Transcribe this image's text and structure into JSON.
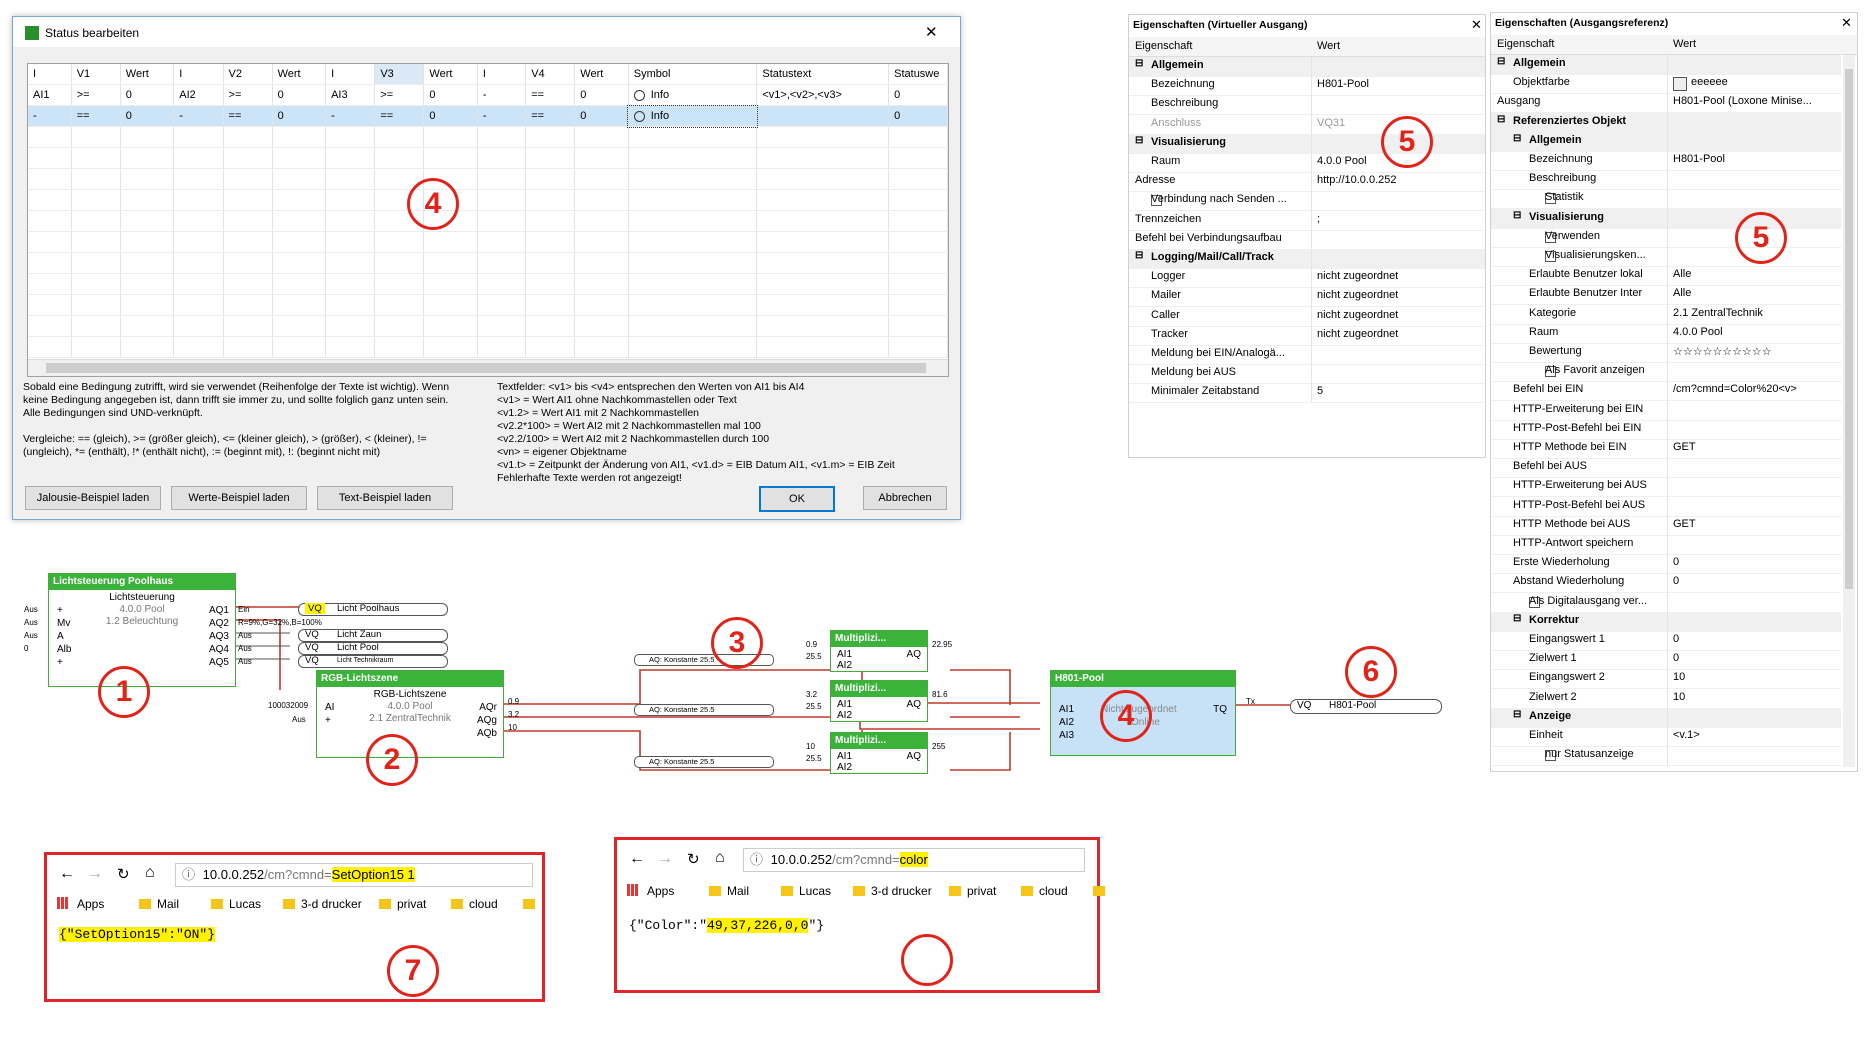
{
  "dialog": {
    "title": "Status bearbeiten",
    "columns": [
      "I",
      "V1",
      "Wert",
      "I",
      "V2",
      "Wert",
      "I",
      "V3",
      "Wert",
      "I",
      "V4",
      "Wert",
      "Symbol",
      "Statustext",
      "Statuswe"
    ],
    "rows": [
      [
        "AI1",
        ">=",
        "0",
        "AI2",
        ">=",
        "0",
        "AI3",
        ">=",
        "0",
        "-",
        "==",
        "0",
        "Info",
        "<v1>,<v2>,<v3>",
        "0"
      ],
      [
        "-",
        "==",
        "0",
        "-",
        "==",
        "0",
        "-",
        "==",
        "0",
        "-",
        "==",
        "0",
        "Info",
        "",
        "0"
      ]
    ],
    "help_left": [
      "Sobald eine Bedingung zutrifft, wird sie verwendet (Reihenfolge der Texte ist wichtig). Wenn",
      "keine Bedingung angegeben ist, dann trifft sie immer zu, und sollte folglich ganz unten sein.",
      "Alle Bedingungen sind UND-verknüpft.",
      "",
      "Vergleiche: == (gleich), >= (größer gleich), <= (kleiner gleich), > (größer), < (kleiner), !=",
      "(ungleich), *= (enthält), !* (enthält nicht), := (beginnt mit), !: (beginnt nicht mit)"
    ],
    "help_right": [
      "Textfelder: <v1> bis <v4> entsprechen den Werten von AI1 bis AI4",
      "<v1> = Wert AI1 ohne Nachkommastellen oder Text",
      "<v1.2> = Wert AI1 mit 2 Nachkommastellen",
      "<v2.2*100> = Wert AI2 mit 2 Nachkommastellen mal 100",
      "<v2.2/100> = Wert AI2 mit 2 Nachkommastellen durch 100",
      "<vn> = eigener Objektname",
      "<v1.t> = Zeitpunkt der Änderung von AI1, <v1.d> = EIB Datum AI1, <v1.m> = EIB Zeit",
      "Fehlerhafte Texte werden rot angezeigt!"
    ],
    "buttons": {
      "jalousie": "Jalousie-Beispiel laden",
      "werte": "Werte-Beispiel laden",
      "text": "Text-Beispiel laden",
      "ok": "OK",
      "cancel": "Abbrechen"
    },
    "close": "✕"
  },
  "panel1": {
    "title": "Eigenschaften (Virtueller Ausgang)",
    "col_key": "Eigenschaft",
    "col_val": "Wert",
    "rows": [
      {
        "k": "Allgemein",
        "v": "",
        "cat": true,
        "ind": 0
      },
      {
        "k": "Bezeichnung",
        "v": "H801-Pool",
        "ind": 1
      },
      {
        "k": "Beschreibung",
        "v": "",
        "ind": 1
      },
      {
        "k": "Anschluss",
        "v": "VQ31",
        "ind": 1,
        "grey": true
      },
      {
        "k": "Visualisierung",
        "v": "",
        "cat": true,
        "ind": 0
      },
      {
        "k": "Raum",
        "v": "4.0.0 Pool",
        "ind": 1
      },
      {
        "k": "Adresse",
        "v": "http://10.0.0.252",
        "ind": 0
      },
      {
        "k": "Verbindung nach Senden ...",
        "v": "",
        "ind": 0,
        "check": true
      },
      {
        "k": "Trennzeichen",
        "v": ";",
        "ind": 0
      },
      {
        "k": "Befehl bei Verbindungsaufbau",
        "v": "",
        "ind": 0
      },
      {
        "k": "Logging/Mail/Call/Track",
        "v": "",
        "cat": true,
        "ind": 0
      },
      {
        "k": "Logger",
        "v": "nicht zugeordnet",
        "ind": 1
      },
      {
        "k": "Mailer",
        "v": "nicht zugeordnet",
        "ind": 1
      },
      {
        "k": "Caller",
        "v": "nicht zugeordnet",
        "ind": 1
      },
      {
        "k": "Tracker",
        "v": "nicht zugeordnet",
        "ind": 1
      },
      {
        "k": "Meldung bei EIN/Analogä...",
        "v": "",
        "ind": 1
      },
      {
        "k": "Meldung bei AUS",
        "v": "",
        "ind": 1
      },
      {
        "k": "Minimaler Zeitabstand",
        "v": "5",
        "ind": 1
      }
    ]
  },
  "panel2": {
    "title": "Eigenschaften (Ausgangsreferenz)",
    "col_key": "Eigenschaft",
    "col_val": "Wert",
    "rows": [
      {
        "k": "Allgemein",
        "v": "",
        "cat": true,
        "ind": 0
      },
      {
        "k": "Objektfarbe",
        "v": "eeeeee",
        "ind": 1,
        "swatch": true
      },
      {
        "k": "Ausgang",
        "v": "H801-Pool (Loxone Minise...",
        "ind": 0
      },
      {
        "k": "Referenziertes Objekt",
        "v": "",
        "cat": true,
        "ind": 0
      },
      {
        "k": "Allgemein",
        "v": "",
        "cat": true,
        "ind": 1
      },
      {
        "k": "Bezeichnung",
        "v": "H801-Pool",
        "ind": 2
      },
      {
        "k": "Beschreibung",
        "v": "",
        "ind": 2
      },
      {
        "k": "Statistik",
        "v": "",
        "ind": 2,
        "check": true
      },
      {
        "k": "Visualisierung",
        "v": "",
        "cat": true,
        "ind": 1
      },
      {
        "k": "Verwenden",
        "v": "",
        "ind": 2,
        "check": true
      },
      {
        "k": "Visualisierungsken...",
        "v": "",
        "ind": 2,
        "check": true
      },
      {
        "k": "Erlaubte Benutzer lokal",
        "v": "Alle",
        "ind": 2
      },
      {
        "k": "Erlaubte Benutzer Inter",
        "v": "Alle",
        "ind": 2
      },
      {
        "k": "Kategorie",
        "v": "2.1 ZentralTechnik",
        "ind": 2
      },
      {
        "k": "Raum",
        "v": "4.0.0 Pool",
        "ind": 2
      },
      {
        "k": "Bewertung",
        "v": "☆☆☆☆☆☆☆☆☆☆",
        "ind": 2
      },
      {
        "k": "Als Favorit anzeigen",
        "v": "",
        "ind": 2,
        "check": true
      },
      {
        "k": "Befehl bei EIN",
        "v": "/cm?cmnd=Color%20<v>",
        "ind": 1
      },
      {
        "k": "HTTP-Erweiterung bei EIN",
        "v": "",
        "ind": 1
      },
      {
        "k": "HTTP-Post-Befehl bei EIN",
        "v": "",
        "ind": 1
      },
      {
        "k": "HTTP Methode bei EIN",
        "v": "GET",
        "ind": 1
      },
      {
        "k": "Befehl bei AUS",
        "v": "",
        "ind": 1
      },
      {
        "k": "HTTP-Erweiterung bei AUS",
        "v": "",
        "ind": 1
      },
      {
        "k": "HTTP-Post-Befehl bei AUS",
        "v": "",
        "ind": 1
      },
      {
        "k": "HTTP Methode bei AUS",
        "v": "GET",
        "ind": 1
      },
      {
        "k": "HTTP-Antwort speichern",
        "v": "",
        "ind": 1
      },
      {
        "k": "Erste Wiederholung",
        "v": "0",
        "ind": 1
      },
      {
        "k": "Abstand Wiederholung",
        "v": "0",
        "ind": 1
      },
      {
        "k": "Als Digitalausgang ver...",
        "v": "",
        "ind": 1,
        "check": true
      },
      {
        "k": "Korrektur",
        "v": "",
        "cat": true,
        "ind": 1
      },
      {
        "k": "Eingangswert 1",
        "v": "0",
        "ind": 2
      },
      {
        "k": "Zielwert 1",
        "v": "0",
        "ind": 2
      },
      {
        "k": "Eingangswert 2",
        "v": "10",
        "ind": 2
      },
      {
        "k": "Zielwert 2",
        "v": "10",
        "ind": 2
      },
      {
        "k": "Anzeige",
        "v": "",
        "cat": true,
        "ind": 1
      },
      {
        "k": "Einheit",
        "v": "<v.1>",
        "ind": 2
      },
      {
        "k": "nur Statusanzeige",
        "v": "",
        "ind": 2,
        "check": true
      }
    ]
  },
  "diagram": {
    "licht": {
      "title": "Lichtsteuerung Poolhaus",
      "sub": "Lichtsteuerung",
      "room": "4.0.0 Pool",
      "cat": "1.2 Beleuchtung",
      "inputs": [
        "+",
        "Mv",
        "A",
        "Alb",
        "+"
      ],
      "outputs": [
        "AQ1",
        "AQ2",
        "AQ3",
        "AQ4",
        "AQ5"
      ],
      "in_labels": [
        "Aus",
        "Aus",
        "Aus",
        "0",
        ""
      ]
    },
    "vq_labels": [
      "Licht Poolhaus",
      "Licht Zaun",
      "Licht Pool",
      "Licht Technikraum"
    ],
    "vq_tag": "VQ",
    "wire_labels": [
      "Ein",
      "R=9%,G=32%,B=100%",
      "Aus",
      "Aus",
      "Aus"
    ],
    "rgb": {
      "title": "RGB-Lichtszene",
      "sub": "RGB-Lichtszene",
      "room": "4.0.0 Pool",
      "cat": "2.1 ZentralTechnik",
      "inputs": [
        "AI",
        "+"
      ],
      "outputs": [
        "AQr",
        "AQg",
        "AQb"
      ],
      "in_value": "100032009",
      "in_aus": "Aus",
      "out_values": [
        "0.9",
        "3.2",
        "10"
      ]
    },
    "multi": [
      {
        "title": "Multiplizi...",
        "in": [
          "AI1",
          "AI2"
        ],
        "out": "AQ",
        "v1": "0.9",
        "v2": "25.5",
        "res": "22.95"
      },
      {
        "title": "Multiplizi...",
        "in": [
          "AI1",
          "AI2"
        ],
        "out": "AQ",
        "v1": "3.2",
        "v2": "25.5",
        "res": "81.6"
      },
      {
        "title": "Multiplizi...",
        "in": [
          "AI1",
          "AI2"
        ],
        "out": "AQ",
        "v1": "10",
        "v2": "25.5",
        "res": "255"
      }
    ],
    "konst": "AQ: Konstante 25.5",
    "h801": {
      "title": "H801-Pool",
      "in": [
        "AI1",
        "AI2",
        "AI3"
      ],
      "out": "TQ",
      "status": "Nicht zugeordnet",
      "state": "Online",
      "tx": "Tx"
    },
    "vq_out": "H801-Pool",
    "circles": [
      "1",
      "2",
      "3",
      "4",
      "4",
      "5",
      "5",
      "6",
      "7"
    ]
  },
  "browser1": {
    "url_prefix": "10.0.0.252",
    "url_path": "/cm?cmnd=",
    "url_hl": "SetOption15 1",
    "bookmarks": [
      "Apps",
      "Mail",
      "Lucas",
      "3-d drucker",
      "privat",
      "cloud"
    ],
    "body": "{\"SetOption15\":\"ON\"}"
  },
  "browser2": {
    "url_prefix": "10.0.0.252",
    "url_path": "/cm?cmnd=",
    "url_hl": "color",
    "bookmarks": [
      "Apps",
      "Mail",
      "Lucas",
      "3-d drucker",
      "privat",
      "cloud"
    ],
    "body_prefix": "{\"Color\":\"",
    "body_hl": "49,37,226,0,0",
    "body_suffix": "\"}"
  },
  "colors": {
    "accent_red": "#e2231a",
    "block_green": "#3bb33b",
    "highlight": "#fff200",
    "selection": "#cce4f7"
  }
}
